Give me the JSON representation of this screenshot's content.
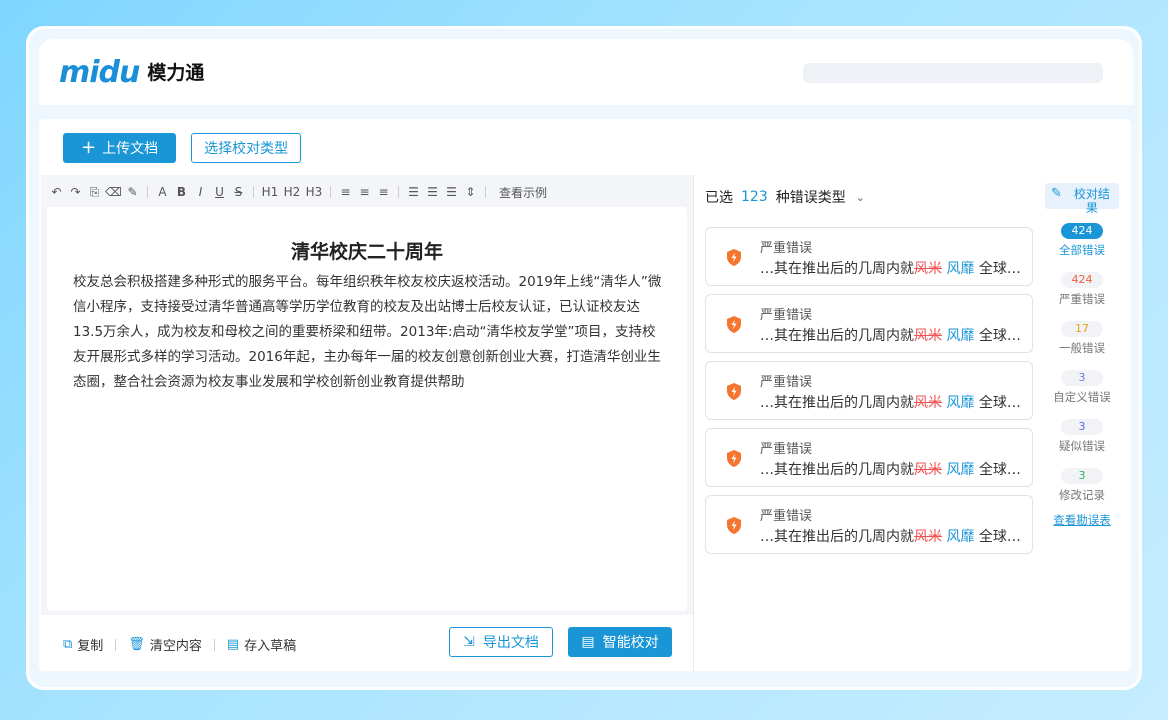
{
  "app": {
    "logo_text": "midu",
    "logo_cn": "模力通"
  },
  "toolbar": {
    "upload_label": "上传文档",
    "select_type_label": "选择校对类型"
  },
  "editor_toolbar": {
    "example_label": "查看示例"
  },
  "document": {
    "title": "清华校庆二十周年",
    "body": "校友总会积极搭建多种形式的服务平台。每年组织秩年校友校庆返校活动。2019年上线“清华人”微信小程序，支持接受过清华普通高等学历学位教育的校友及出站博士后校友认证，已认证校友达13.5万余人，成为校友和母校之间的重要桥梁和纽带。2013年:启动“清华校友学堂”项目，支持校友开展形式多样的学习活动。2016年起，主办每年一届的校友创意创新创业大赛，打造清华创业生态圈，整合社会资源为校友事业发展和学校创新创业教育提供帮助"
  },
  "footer": {
    "copy_label": "复制",
    "clear_label": "清空内容",
    "draft_label": "存入草稿",
    "export_label": "导出文档",
    "check_label": "智能校对"
  },
  "results": {
    "selected_prefix": "已选",
    "selected_count": "123",
    "selected_suffix": "种错误类型",
    "errors": [
      {
        "type": "严重错误",
        "prefix": "…其在推出后的几周内就",
        "wrong": "风米",
        "fix": "风靡",
        "suffix": "全球…"
      },
      {
        "type": "严重错误",
        "prefix": "…其在推出后的几周内就",
        "wrong": "风米",
        "fix": "风靡",
        "suffix": "全球…"
      },
      {
        "type": "严重错误",
        "prefix": "…其在推出后的几周内就",
        "wrong": "风米",
        "fix": "风靡",
        "suffix": "全球…"
      },
      {
        "type": "严重错误",
        "prefix": "…其在推出后的几周内就",
        "wrong": "风米",
        "fix": "风靡",
        "suffix": "全球…"
      },
      {
        "type": "严重错误",
        "prefix": "…其在推出后的几周内就",
        "wrong": "风米",
        "fix": "风靡",
        "suffix": "全球…"
      }
    ]
  },
  "sidebar": {
    "header_label": "校对结果",
    "items": [
      {
        "count": "424",
        "label": "全部错误",
        "color": "#1a96d7"
      },
      {
        "count": "424",
        "label": "严重错误",
        "color": "#f0603c"
      },
      {
        "count": "17",
        "label": "一般错误",
        "color": "#e8a617"
      },
      {
        "count": "3",
        "label": "自定义错误",
        "color": "#6a7bd8"
      },
      {
        "count": "3",
        "label": "疑似错误",
        "color": "#5a6fd8"
      },
      {
        "count": "3",
        "label": "修改记录",
        "color": "#2fb36b"
      }
    ],
    "table_link": "查看勘误表"
  }
}
